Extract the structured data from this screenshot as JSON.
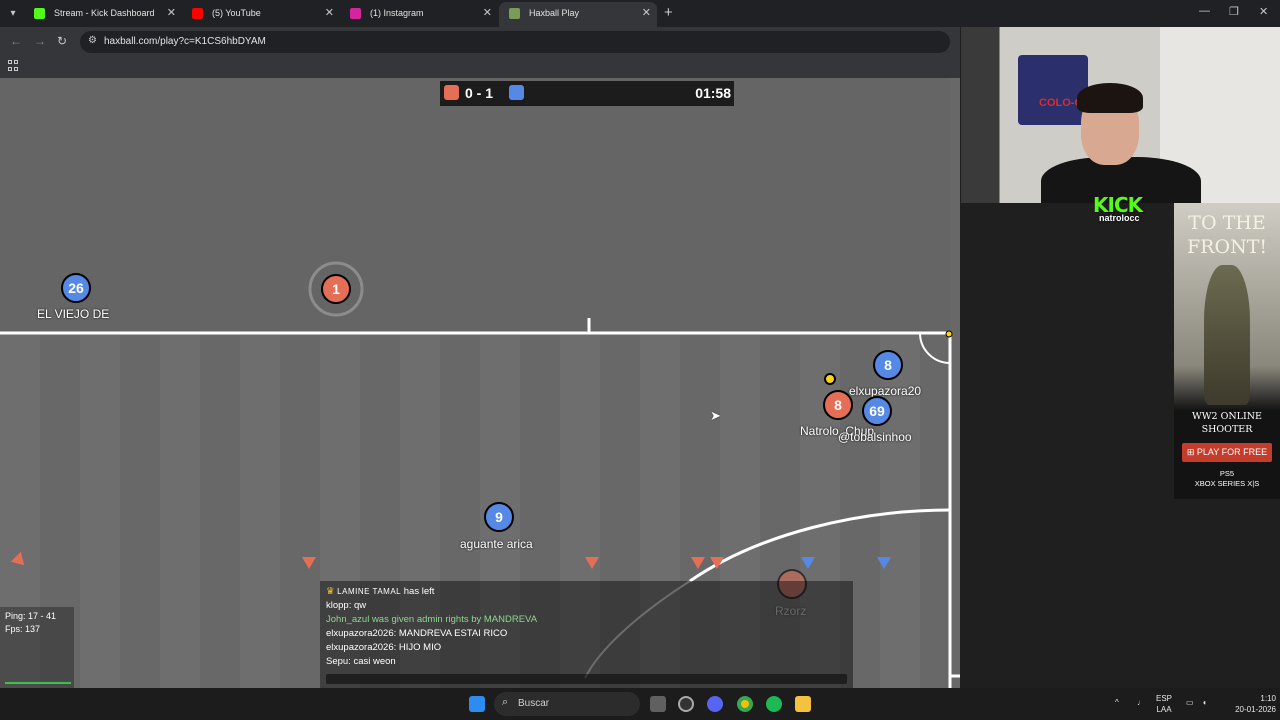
{
  "browser": {
    "tabs": [
      {
        "label": "Stream - Kick Dashboard",
        "color": "#53fc18"
      },
      {
        "label": "(5) YouTube",
        "color": "#ff0000"
      },
      {
        "label": "(1) Instagram",
        "color": "#d6249f"
      },
      {
        "label": "Haxball Play",
        "color": "#7a9c5a"
      }
    ],
    "active_tab": 3,
    "url": "haxball.com/play?c=K1CS6hbDYAM"
  },
  "game": {
    "score_red": "0",
    "score_sep": "-",
    "score_blue": "1",
    "score_text": "0 - 1",
    "time": "01:58",
    "players": [
      {
        "number": "26",
        "team": "blue",
        "name": "EL VIEJO DE"
      },
      {
        "number": "1",
        "team": "red",
        "name": ""
      },
      {
        "number": "8",
        "team": "blue",
        "name": "elxupazora20"
      },
      {
        "number": "8",
        "team": "red",
        "name": "Natrolo_Chup"
      },
      {
        "number": "69",
        "team": "blue",
        "name": "@tobalsinhoo"
      },
      {
        "number": "9",
        "team": "blue",
        "name": "aguante arica"
      },
      {
        "number": "",
        "team": "red",
        "name": "Rzorz"
      }
    ],
    "colors": {
      "red": "#e56e56",
      "blue": "#5689e5",
      "ball": "#ffd21a"
    }
  },
  "chat": {
    "lines": [
      {
        "prefix": "LAMINE TAMAL",
        "text": " has left"
      },
      {
        "text": "klopp: qw"
      },
      {
        "text": "John_azul was given admin rights by MANDREVA"
      },
      {
        "text": "elxupazora2026: MANDREVA ESTAI RICO"
      },
      {
        "text": "elxupazora2026: HIJO MIO"
      },
      {
        "text": "Sepu: casi weon"
      }
    ]
  },
  "stats": {
    "ping": "Ping: 17 - 41",
    "fps": "Fps: 137"
  },
  "overlay": {
    "brand": "KICK",
    "channel": "natrolocc",
    "flag_text": "COLO-C"
  },
  "ad": {
    "headline": "TO THE FRONT!",
    "title": "WW2 ONLINE SHOOTER",
    "button": "PLAY FOR FREE",
    "platform1": "PS5",
    "platform2": "XBOX SERIES X|S"
  },
  "taskbar": {
    "search_placeholder": "Buscar",
    "lang_top": "ESP",
    "lang_bottom": "LAA",
    "time": "1:10",
    "date": "20-01-2026"
  }
}
